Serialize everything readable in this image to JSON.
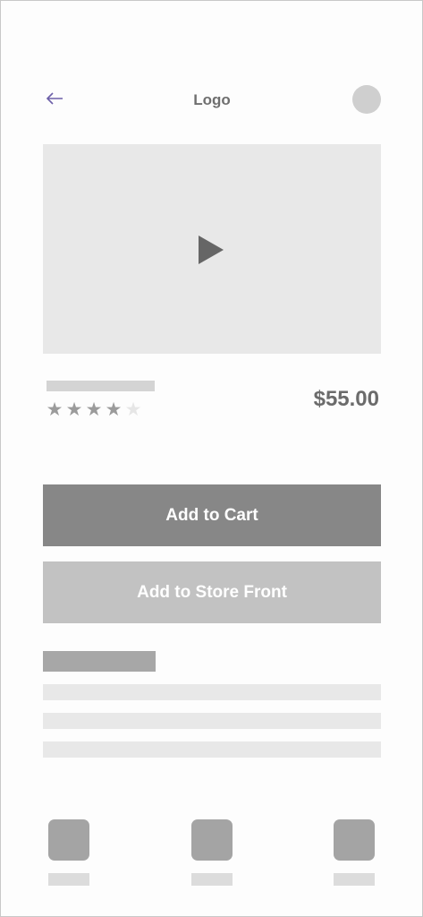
{
  "header": {
    "back_icon": "arrow-left-icon",
    "logo_text": "Logo",
    "avatar_icon": "user-avatar-icon",
    "accent_color": "#6c5fa8"
  },
  "video": {
    "play_icon": "play-icon"
  },
  "product": {
    "price": "$55.00",
    "rating": 4,
    "rating_max": 5,
    "stars": [
      "★",
      "★",
      "★",
      "★",
      "★"
    ]
  },
  "actions": {
    "add_to_cart_label": "Add to Cart",
    "add_to_store_front_label": "Add to Store Front"
  },
  "bottom_nav": {
    "items": [
      {
        "icon": "nav-placeholder-icon"
      },
      {
        "icon": "nav-placeholder-icon"
      },
      {
        "icon": "nav-placeholder-icon"
      }
    ]
  }
}
